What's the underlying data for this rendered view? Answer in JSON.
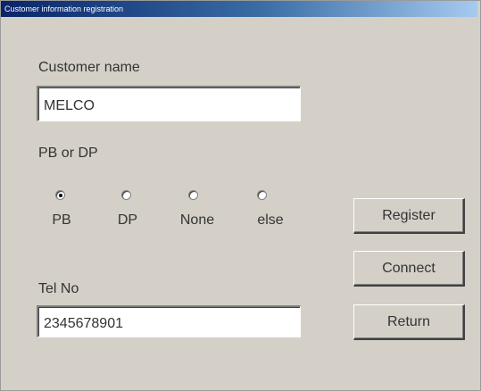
{
  "window": {
    "title": "Customer information registration"
  },
  "form": {
    "customer_name": {
      "label": "Customer name",
      "value": "MELCO"
    },
    "pb_or_dp": {
      "label": "PB or DP",
      "options": [
        {
          "label": "PB",
          "selected": true
        },
        {
          "label": "DP",
          "selected": false
        },
        {
          "label": "None",
          "selected": false
        },
        {
          "label": "else",
          "selected": false
        }
      ]
    },
    "tel_no": {
      "label": "Tel No",
      "value": "2345678901"
    }
  },
  "buttons": {
    "register": "Register",
    "connect": "Connect",
    "return": "Return"
  },
  "colors": {
    "window_background": "#d4d0c8",
    "title_bar_start": "#0a246a",
    "title_bar_end": "#a6caf0"
  }
}
